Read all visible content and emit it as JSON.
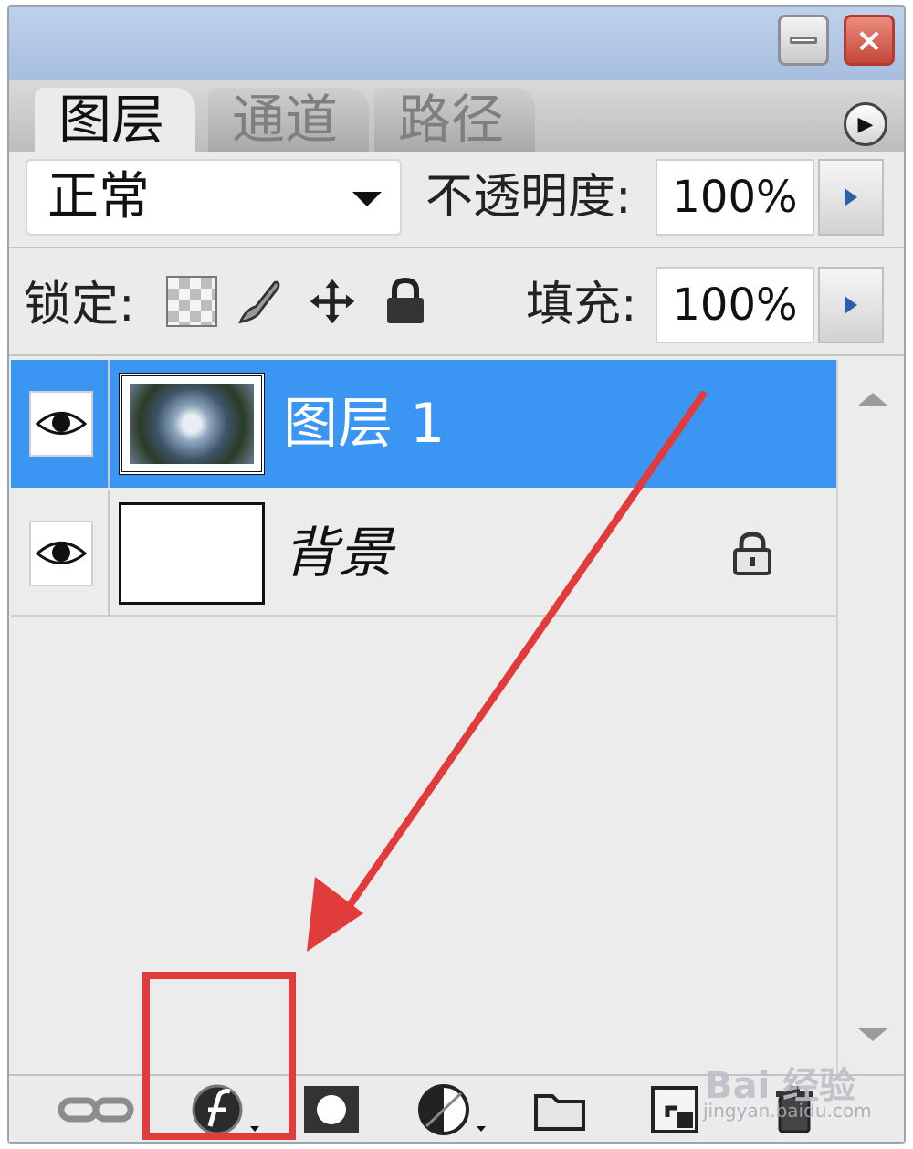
{
  "window": {
    "minimize_label": "minimize",
    "close_label": "×"
  },
  "tabs": [
    {
      "label": "图层",
      "active": true
    },
    {
      "label": "通道",
      "active": false
    },
    {
      "label": "路径",
      "active": false
    }
  ],
  "blend": {
    "mode": "正常",
    "opacity_label": "不透明度:",
    "opacity_value": "100%"
  },
  "lock": {
    "label": "锁定:",
    "fill_label": "填充:",
    "fill_value": "100%",
    "icons": [
      "lock-transparent-pixels-icon",
      "lock-image-pixels-icon",
      "lock-position-icon",
      "lock-all-icon"
    ]
  },
  "layers": [
    {
      "name": "图层 1",
      "selected": true,
      "visible": true
    },
    {
      "name": "背景",
      "selected": false,
      "visible": true,
      "locked": true
    }
  ],
  "bottom_toolbar": {
    "icons": [
      "link-layers-icon",
      "layer-style-fx-icon",
      "add-mask-icon",
      "adjustment-layer-icon",
      "new-group-folder-icon",
      "new-layer-icon",
      "delete-layer-icon"
    ]
  },
  "watermark": {
    "main": "Bai 经验",
    "sub": "jingyan.baidu.com"
  },
  "colors": {
    "selected_row": "#3b95f3",
    "annotation": "#e23b3b",
    "panel_bg": "#ebebeb"
  }
}
